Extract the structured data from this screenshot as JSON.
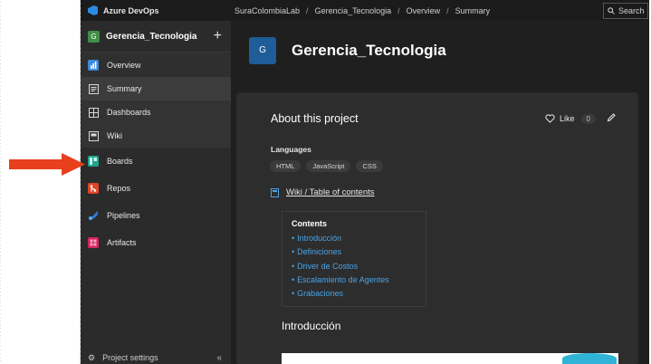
{
  "topbar": {
    "brand": "Azure DevOps",
    "breadcrumbs": [
      "SuraColombiaLab",
      "Gerencia_Tecnologia",
      "Overview",
      "Summary"
    ],
    "search_label": "Search"
  },
  "sidebar": {
    "project_initial": "G",
    "project_name": "Gerencia_Tecnologia",
    "items": [
      {
        "label": "Overview",
        "icon": "overview-icon"
      },
      {
        "label": "Summary",
        "icon": "summary-icon"
      },
      {
        "label": "Dashboards",
        "icon": "dashboards-icon"
      },
      {
        "label": "Wiki",
        "icon": "wiki-icon"
      },
      {
        "label": "Boards",
        "icon": "boards-icon"
      },
      {
        "label": "Repos",
        "icon": "repos-icon"
      },
      {
        "label": "Pipelines",
        "icon": "pipelines-icon"
      },
      {
        "label": "Artifacts",
        "icon": "artifacts-icon"
      }
    ],
    "footer_label": "Project settings"
  },
  "main": {
    "project_initial": "G",
    "project_title": "Gerencia_Tecnologia",
    "about_title": "About this project",
    "like_label": "Like",
    "like_count": "0",
    "languages_label": "Languages",
    "languages": [
      "HTML",
      "JavaScript",
      "CSS"
    ],
    "wiki_link": "Wiki / Table of contents",
    "contents_title": "Contents",
    "toc": [
      "Introducción",
      "Definiciones",
      "Driver de Costos",
      "Escalamiento de Agentes",
      "Grabaciones"
    ],
    "intro_heading": "Introducción"
  },
  "colors": {
    "accent": "#4aa3e6",
    "annotation_arrow": "#e8401c",
    "project_avatar": "#1e5d98"
  }
}
